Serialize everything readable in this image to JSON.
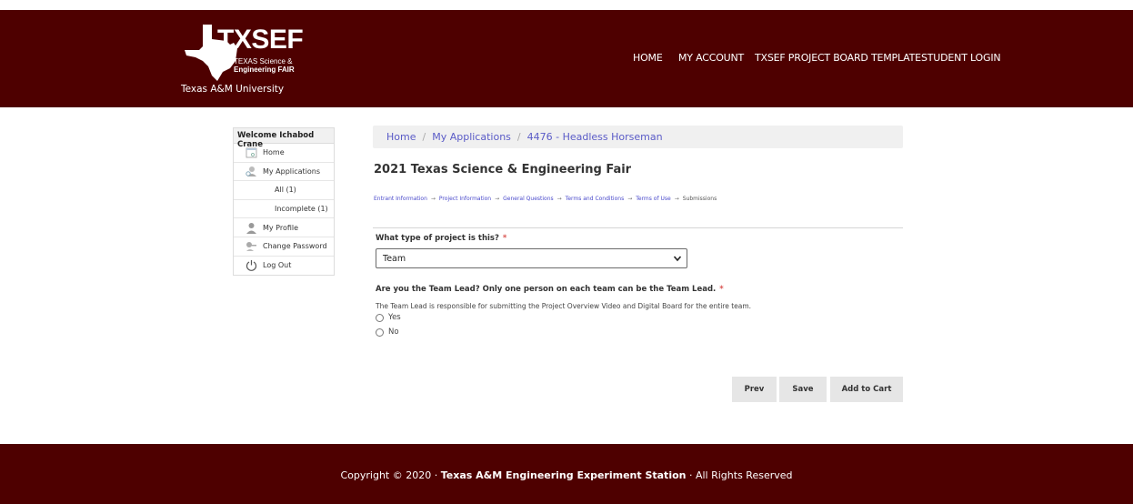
{
  "header": {
    "logo": {
      "main": "TXSEF",
      "line1": "TEXAS Science &",
      "line2": "Engineering FAIR"
    },
    "university": "Texas A&M University",
    "nav": [
      "HOME",
      "MY ACCOUNT",
      "TXSEF PROJECT BOARD TEMPLATE",
      "STUDENT LOGIN"
    ]
  },
  "sidebar": {
    "welcome": "Welcome Ichabod Crane",
    "items": [
      {
        "label": "Home",
        "icon": "home-page-icon"
      },
      {
        "label": "My Applications",
        "icon": "user-search-icon"
      },
      {
        "label": "All (1)"
      },
      {
        "label": "Incomplete (1)"
      },
      {
        "label": "My Profile",
        "icon": "profile-icon"
      },
      {
        "label": "Change Password",
        "icon": "key-icon"
      },
      {
        "label": "Log Out",
        "icon": "power-icon"
      }
    ]
  },
  "breadcrumb": [
    "Home",
    "My Applications",
    "4476 - Headless Horseman"
  ],
  "page_title": "2021 Texas Science & Engineering Fair",
  "steps": [
    "Entrant Information",
    "Project Information",
    "General Questions",
    "Terms and Conditions",
    "Terms of Use",
    "Submissions"
  ],
  "form": {
    "q1": {
      "label": "What type of project is this?",
      "required": "*",
      "value": "Team"
    },
    "q2": {
      "label": "Are you the Team Lead? Only one person on each team can be the Team Lead.",
      "required": "*",
      "help": "The Team Lead is responsible for submitting the Project Overview Video and Digital Board for the entire team.",
      "options": [
        "Yes",
        "No"
      ]
    }
  },
  "buttons": {
    "prev": "Prev",
    "save": "Save",
    "add_to_cart": "Add to Cart"
  },
  "footer": {
    "prefix": "Copyright © 2020 · ",
    "org": "Texas A&M Engineering Experiment Station",
    "suffix": " · All Rights Reserved"
  },
  "colors": {
    "maroon": "#4e0000",
    "link": "#5a5bc7",
    "required": "#d9534f"
  }
}
